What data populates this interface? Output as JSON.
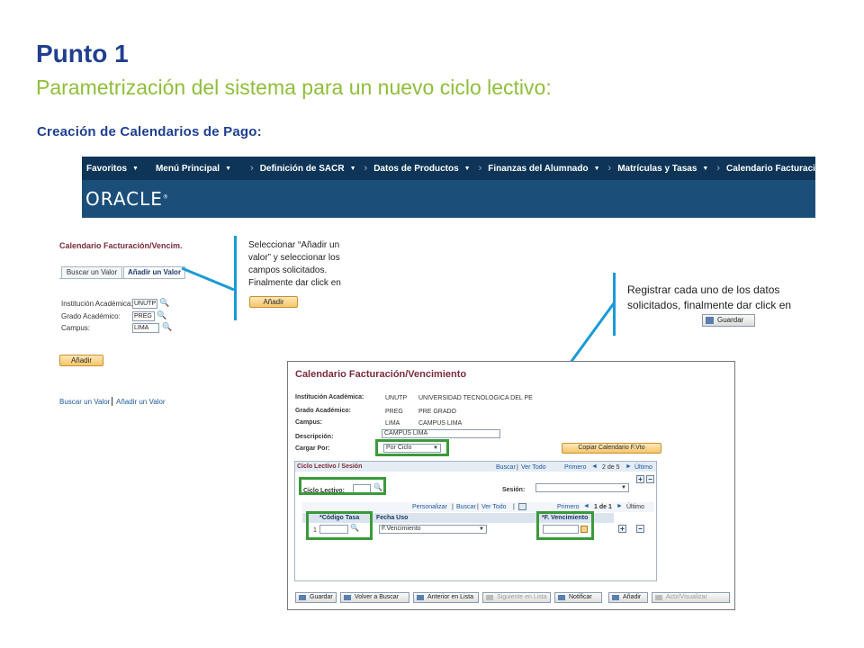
{
  "slide": {
    "title": "Punto 1",
    "subtitle": "Parametrización del sistema para un nuevo ciclo lectivo:",
    "section": "Creación de Calendarios de Pago:"
  },
  "menubar": {
    "items": [
      "Favoritos",
      "Menú Principal",
      "Definición de SACR",
      "Datos de Productos",
      "Finanzas del Alumnado",
      "Matrículas y Tasas",
      "Calendario Facturación/Vencim."
    ]
  },
  "banner": {
    "logo": "ORACLE",
    "logo_mark": "®"
  },
  "left_page": {
    "title": "Calendario Facturación/Vencim.",
    "tabs": [
      "Buscar un Valor",
      "Añadir un Valor"
    ],
    "fields": [
      {
        "label": "Institución Académica:",
        "value": "UNUTP"
      },
      {
        "label": "Grado Académico:",
        "value": "PREG"
      },
      {
        "label": "Campus:",
        "value": "LIMA"
      }
    ],
    "add_button": "Añadir",
    "links": [
      "Buscar un Valor",
      "Añadir un Valor"
    ]
  },
  "callout_left": {
    "text": "Seleccionar “Añadir un valor” y seleccionar los campos solicitados. Finalmente dar click en",
    "button": "Añadir"
  },
  "callout_right": {
    "text": "Registrar cada uno de los datos solicitados, finalmente dar click en",
    "button": "Guardar"
  },
  "panel": {
    "title": "Calendario Facturación/Vencimiento",
    "institucion_label": "Institución Académica:",
    "institucion_code": "UNUTP",
    "institucion_name": "UNIVERSIDAD TECNOLOGICA DEL PE",
    "grado_label": "Grado Académico:",
    "grado_code": "PREG",
    "grado_name": "PRE GRADO",
    "campus_label": "Campus:",
    "campus_code": "LIMA",
    "campus_name": "CAMPUS LIMA",
    "descripcion_label": "Descripción:",
    "descripcion_value": "CAMPUS LIMA",
    "cargar_label": "Cargar Por:",
    "cargar_value": "Por Ciclo",
    "copiar_button": "Copiar Calendario F.Vto",
    "ciclo_section": "Ciclo Lectivo / Sesión",
    "ciclo_nav": {
      "find": "Buscar",
      "view_all": "Ver Todo",
      "first": "Primero",
      "range": "2 de 5",
      "last": "Último"
    },
    "ciclo_label": "Ciclo Lectivo:",
    "sesion_label": "Sesión:",
    "grid_nav": {
      "personalize": "Personalizar",
      "find": "Buscar",
      "view_all": "Ver Todo",
      "first": "Primero",
      "range": "1 de 1",
      "last": "Último"
    },
    "grid_headers": [
      "*Código Tasa",
      "Fecha Uso",
      "*F. Vencimiento"
    ],
    "row": {
      "num": "1",
      "fecha_uso": "F.Vencimiento"
    },
    "buttons": [
      "Guardar",
      "Volver a Buscar",
      "Anterior en Lista",
      "Siguiente en Lista",
      "Notificar",
      "Añadir",
      "Actz/Visualizar"
    ]
  },
  "colors": {
    "title": "#1f3f8f",
    "subtitle": "#8fbe3a",
    "banner": "#1b4f7a",
    "callout": "#1a9ad6",
    "highlight": "#3a9a3a"
  }
}
